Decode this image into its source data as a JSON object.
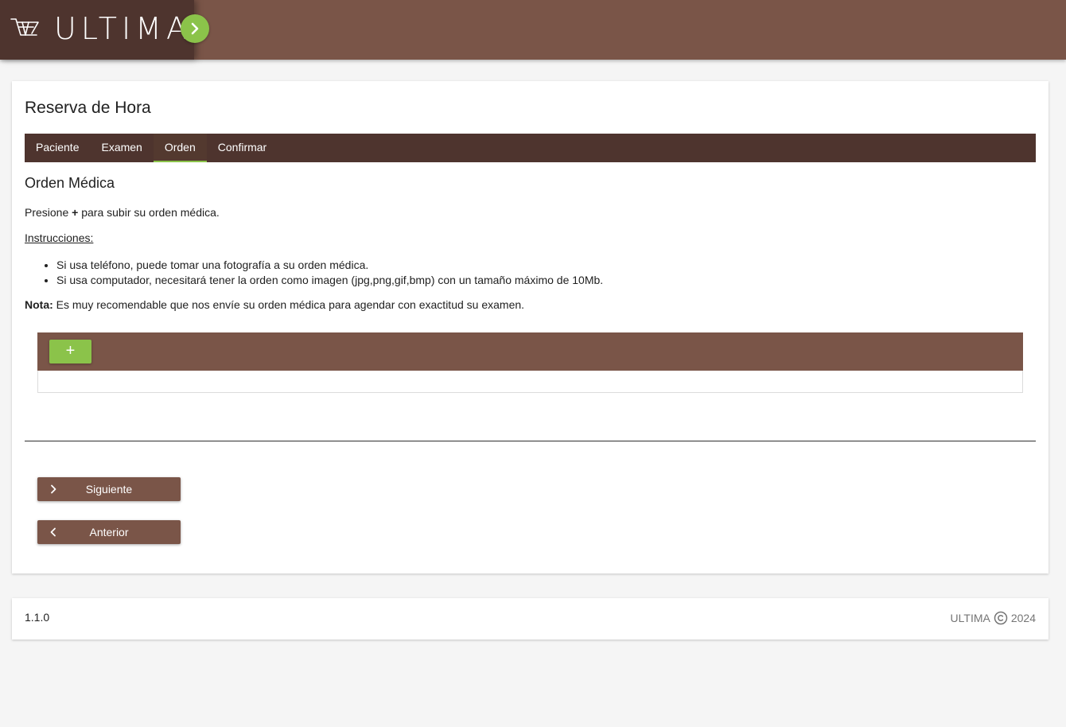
{
  "header": {
    "logo_text": "ULTIMA"
  },
  "page": {
    "title": "Reserva de Hora"
  },
  "tabs": [
    {
      "label": "Paciente",
      "active": false
    },
    {
      "label": "Examen",
      "active": false
    },
    {
      "label": "Orden",
      "active": true
    },
    {
      "label": "Confirmar",
      "active": false
    }
  ],
  "content": {
    "section_title": "Orden Médica",
    "instruction_prefix": "Presione ",
    "instruction_plus": "+",
    "instruction_suffix": " para subir su orden médica.",
    "instructions_heading": "Instrucciones:",
    "bullets": [
      "Si usa teléfono, puede tomar una fotografía a su orden médica.",
      "Si usa computador, necesitará tener la orden como imagen (jpg,png,gif,bmp) con un tamaño máximo de 10Mb."
    ],
    "note_label": "Nota:",
    "note_text": " Es muy recomendable que nos envíe su orden médica para agendar con exactitud su examen."
  },
  "upload": {
    "add_label": "+"
  },
  "buttons": {
    "next": "Siguiente",
    "prev": "Anterior"
  },
  "footer": {
    "version": "1.1.0",
    "brand": "ULTIMA",
    "year": "2024"
  },
  "colors": {
    "brand_brown": "#7a5548",
    "dark_brown": "#4e342e",
    "accent_green": "#8bc34a",
    "background": "#f5f5f5"
  },
  "icons": {
    "logo": "shopping-cart-logo-icon",
    "menu": "chevron-right-icon",
    "next": "chevron-right-icon",
    "prev": "chevron-left-icon",
    "copyright": "copyright-icon"
  }
}
